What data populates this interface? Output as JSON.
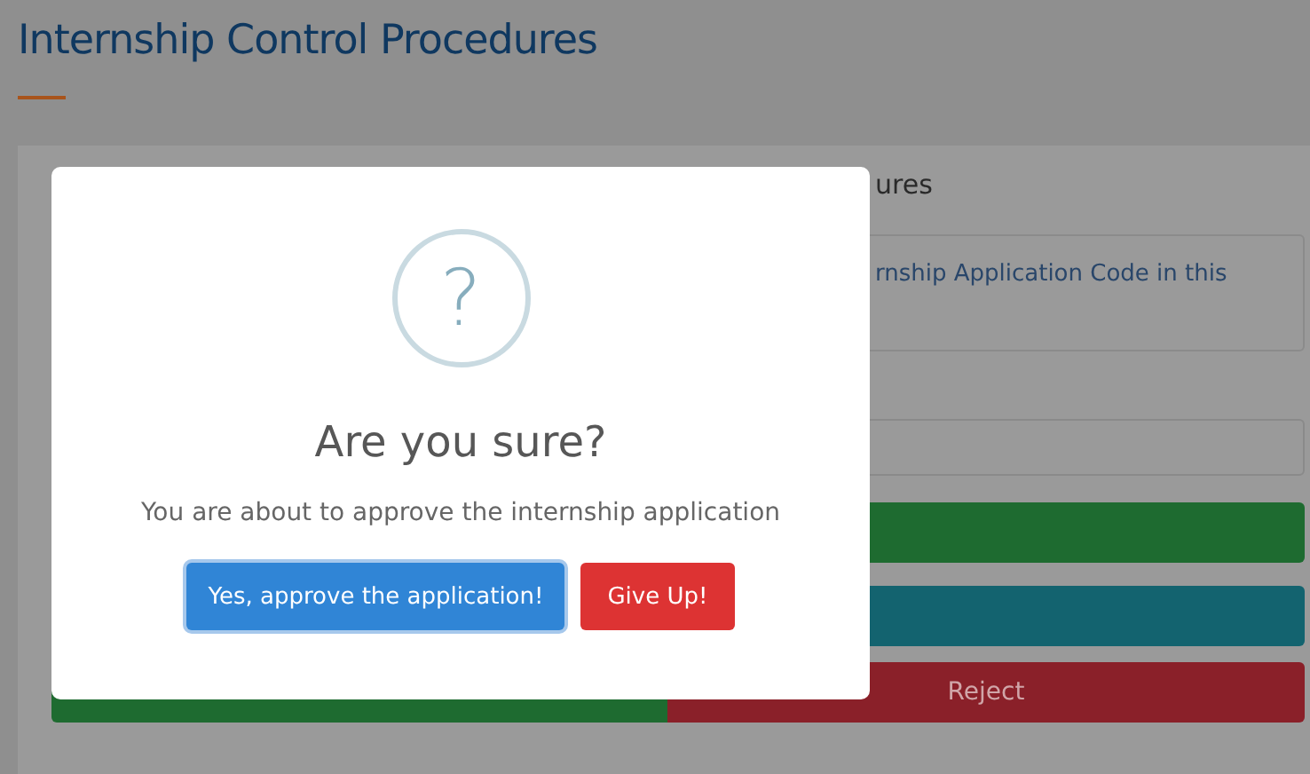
{
  "page": {
    "title": "Internship Control Procedures"
  },
  "panel": {
    "heading_visible": "ures",
    "info_visible": "rnship Application Code in this",
    "reject_button": "Reject"
  },
  "dialog": {
    "icon": "?",
    "title": "Are you sure?",
    "message": "You are about to approve the internship application",
    "buttons": [
      {
        "label": "Yes, approve the application!",
        "kind": "confirm",
        "focused": true
      },
      {
        "label": "Give Up!",
        "kind": "cancel",
        "focused": false
      }
    ]
  }
}
